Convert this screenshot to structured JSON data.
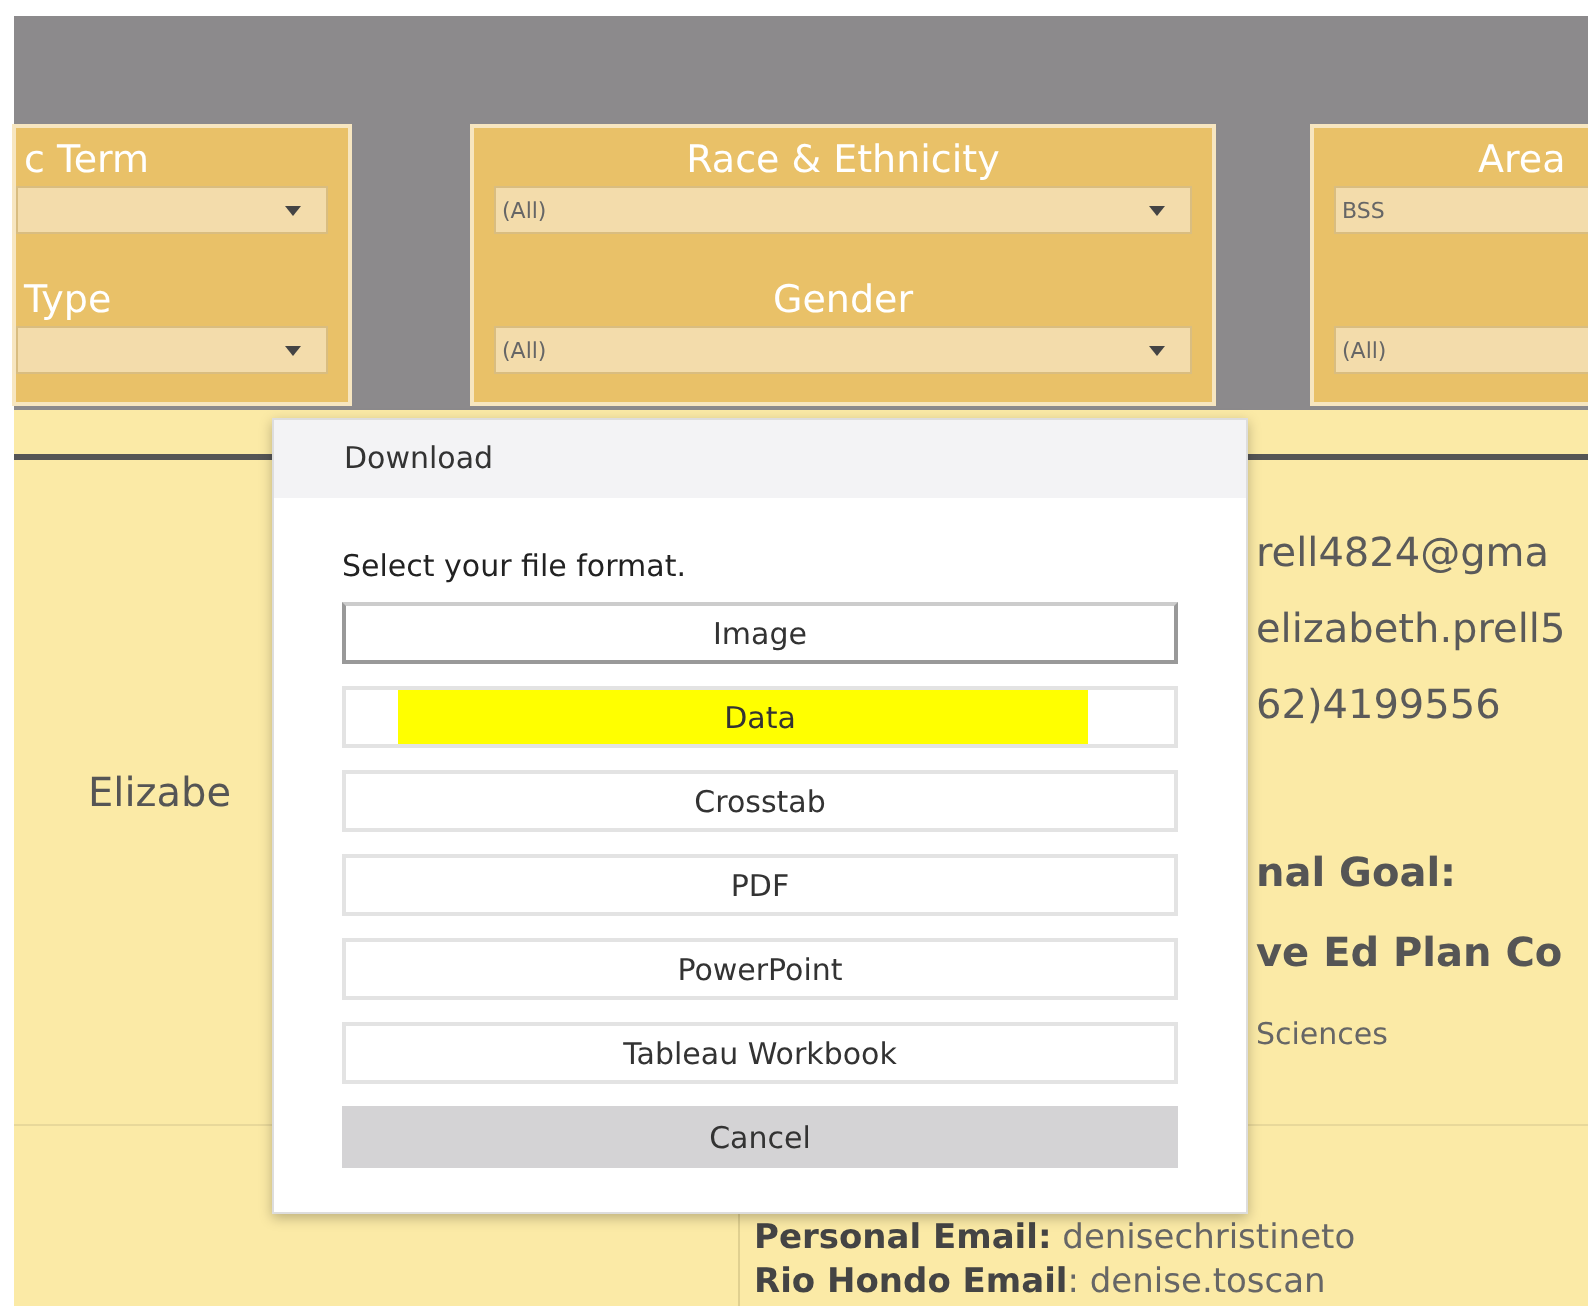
{
  "filters": [
    {
      "title": "c Term",
      "dropdowns": [
        {
          "kind": "select"
        },
        {
          "kind": "select",
          "label": "Type"
        }
      ],
      "arrows": true
    },
    {
      "title": "Race & Ethnicity",
      "dropdowns": [
        {
          "kind": "select",
          "value": "(All)"
        },
        {
          "kind": "select",
          "label": "Gender",
          "value": "(All)"
        }
      ],
      "arrows": true
    },
    {
      "title": "Area",
      "dropdowns": [
        {
          "kind": "select",
          "value": "BSS"
        },
        {
          "kind": "select",
          "value": "(All)"
        }
      ],
      "arrows": false
    }
  ],
  "profile": {
    "name": "Elizabe",
    "contacts": [
      "rell4824@gma",
      "elizabeth.prell5",
      "62)4199556"
    ],
    "goal_label": "nal Goal:",
    "goal_value": "ve Ed Plan Co",
    "area": "Sciences"
  },
  "next_profile": {
    "lines": [
      "**Personal Email:** denisechristineto",
      "**Rio Hondo Email**: denise.toscan"
    ]
  },
  "dialog": {
    "title": "Download",
    "prompt": "Select your file format.",
    "buttons": [
      {
        "label": "Image",
        "kind": "option",
        "focused": true,
        "highlighted": false
      },
      {
        "label": "Data",
        "kind": "option",
        "focused": false,
        "highlighted": true
      },
      {
        "label": "Crosstab",
        "kind": "option",
        "focused": false,
        "highlighted": false
      },
      {
        "label": "PDF",
        "kind": "option",
        "focused": false,
        "highlighted": false
      },
      {
        "label": "PowerPoint",
        "kind": "option",
        "focused": false,
        "highlighted": false
      },
      {
        "label": "Tableau Workbook",
        "kind": "option",
        "focused": false,
        "highlighted": false
      },
      {
        "label": "Cancel",
        "kind": "cancel"
      }
    ]
  }
}
